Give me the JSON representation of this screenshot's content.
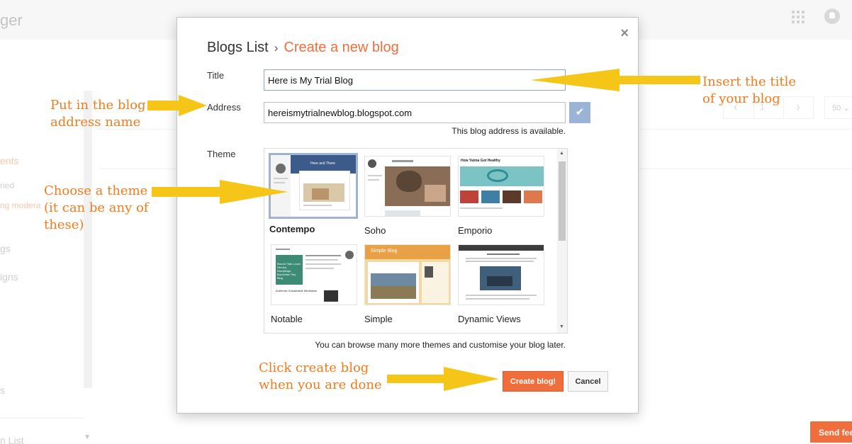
{
  "background": {
    "logo_fragment": "ger",
    "sidebar": [
      "ents",
      "ned",
      "ng modera",
      "gs",
      "igns",
      "s",
      "n List"
    ],
    "pager_number": "1",
    "per_page": "50 ⌄",
    "send_feedback": "Send feedback"
  },
  "dialog": {
    "breadcrumb_parent": "Blogs List",
    "breadcrumb_sep": "›",
    "breadcrumb_current": "Create a new blog",
    "close_glyph": "×",
    "title_label": "Title",
    "title_value": "Here is My Trial Blog",
    "address_label": "Address",
    "address_value": "hereismytrialnewblog.blogspot.com",
    "check_glyph": "✔",
    "availability": "This blog address is available.",
    "theme_label": "Theme",
    "themes": [
      {
        "name": "Contempo",
        "selected": true
      },
      {
        "name": "Soho",
        "selected": false
      },
      {
        "name": "Emporio",
        "selected": false
      },
      {
        "name": "Notable",
        "selected": false
      },
      {
        "name": "Simple",
        "selected": false
      },
      {
        "name": "Dynamic Views",
        "selected": false
      }
    ],
    "thumb_text": {
      "contempo_header": "Here and There",
      "emporio_header": "How Yaima Got Healthy",
      "notable_feature": "Brunch Talk: Local Heroes, Dumplings, Brunchies Tiny Blog",
      "notable_sub": "Authentic Sustainable Meditation",
      "simple_header": "Simple Blog"
    },
    "browse_note": "You can browse many more themes and customise your blog later.",
    "create_label": "Create blog!",
    "cancel_label": "Cancel"
  },
  "annotations": {
    "title_hint": [
      "Insert the title",
      "of your blog"
    ],
    "address_hint": [
      "Put in the blog",
      "address name"
    ],
    "theme_hint": [
      "Choose a theme",
      "(it can be any of",
      "these)"
    ],
    "create_hint": [
      "Click create blog",
      "when you are done"
    ]
  },
  "colors": {
    "accent": "#f06e3c",
    "annotation": "#f07c1e",
    "arrow": "#f5c518",
    "selection": "#a0b3cf"
  }
}
